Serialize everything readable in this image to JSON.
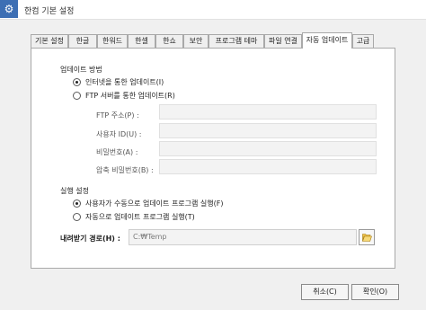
{
  "window": {
    "title": "한컴 기본 설정",
    "icon": "gear-icon"
  },
  "tabs": [
    {
      "label": "기본 설정",
      "active": false
    },
    {
      "label": "한글",
      "active": false
    },
    {
      "label": "한워드",
      "active": false
    },
    {
      "label": "한셀",
      "active": false
    },
    {
      "label": "한쇼",
      "active": false
    },
    {
      "label": "보안",
      "active": false
    },
    {
      "label": "프로그램 테마",
      "active": false
    },
    {
      "label": "파일 연결",
      "active": false
    },
    {
      "label": "자동 업데이트",
      "active": true
    },
    {
      "label": "고급",
      "active": false
    }
  ],
  "update_method": {
    "title": "업데이트 방법",
    "options": [
      {
        "label": "인터넷을 통한 업데이트(I)",
        "checked": true
      },
      {
        "label": "FTP 서버를 통한 업데이트(R)",
        "checked": false
      }
    ],
    "fields": [
      {
        "label": "FTP 주소(P) :",
        "value": ""
      },
      {
        "label": "사용자 ID(U) :",
        "value": ""
      },
      {
        "label": "비밀번호(A) :",
        "value": ""
      },
      {
        "label": "압축 비밀번호(B) :",
        "value": ""
      }
    ]
  },
  "run_settings": {
    "title": "실행 설정",
    "options": [
      {
        "label": "사용자가 수동으로 업데이트 프로그램 실행(F)",
        "checked": true
      },
      {
        "label": "자동으로 업데이트 프로그램 실행(T)",
        "checked": false
      }
    ]
  },
  "download_path": {
    "label": "내려받기 경로(H) :",
    "value": "C:₩Temp",
    "button_icon": "folder-open-icon"
  },
  "buttons": {
    "cancel": "취소(C)",
    "ok": "확인(O)"
  }
}
